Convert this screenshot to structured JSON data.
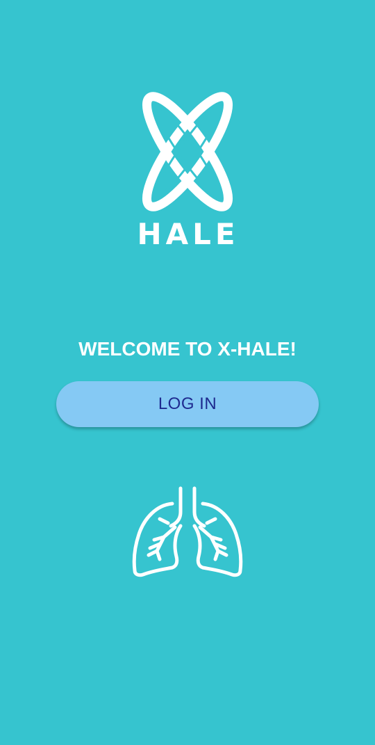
{
  "app": {
    "logo_text": "HALE",
    "logo_icon": "x-orbit-logo-icon"
  },
  "welcome": {
    "title": "WELCOME TO X-HALE!"
  },
  "login": {
    "label": "LOG IN"
  },
  "illustration": {
    "icon": "lungs-icon"
  },
  "colors": {
    "background": "#36c4cf",
    "button": "#85c9f4",
    "button_text": "#1e2a8f",
    "foreground": "#ffffff"
  }
}
